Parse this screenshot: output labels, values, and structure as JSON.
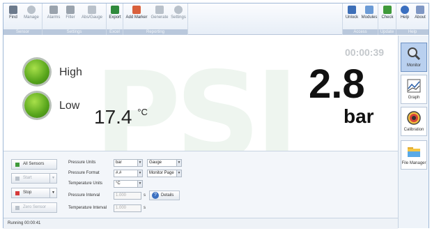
{
  "ribbon": {
    "groups": [
      {
        "label": "Sensor",
        "buttons": [
          {
            "label": "Find",
            "enabled": true
          },
          {
            "label": "Manage",
            "enabled": false
          }
        ]
      },
      {
        "label": "Settings",
        "buttons": [
          {
            "label": "Alarms",
            "enabled": false
          },
          {
            "label": "Filter",
            "enabled": false
          },
          {
            "label": "Abs/Gauge",
            "enabled": false
          }
        ]
      },
      {
        "label": "Excel",
        "buttons": [
          {
            "label": "Export",
            "enabled": true
          }
        ]
      },
      {
        "label": "Reporting",
        "buttons": [
          {
            "label": "Add Marker",
            "enabled": true
          },
          {
            "label": "Generate",
            "enabled": false
          },
          {
            "label": "Settings",
            "enabled": false
          }
        ]
      },
      {
        "label": "Access",
        "buttons": [
          {
            "label": "Unlock",
            "enabled": true
          },
          {
            "label": "Modules",
            "enabled": true
          }
        ]
      },
      {
        "label": "Update",
        "buttons": [
          {
            "label": "Check",
            "enabled": true
          }
        ]
      },
      {
        "label": "Help",
        "buttons": [
          {
            "label": "Help",
            "enabled": true
          },
          {
            "label": "About",
            "enabled": true
          }
        ]
      }
    ]
  },
  "monitor": {
    "timer": "00:00:39",
    "high_label": "High",
    "low_label": "Low",
    "temperature": "17.4",
    "temperature_unit": "°C",
    "pressure": "2.8",
    "pressure_unit": "bar",
    "watermark": "PSI"
  },
  "side": {
    "items": [
      {
        "label": "Monitor",
        "selected": true
      },
      {
        "label": "Graph",
        "selected": false
      },
      {
        "label": "Calibration",
        "selected": false
      },
      {
        "label": "File Manager",
        "selected": false
      }
    ]
  },
  "controls": {
    "all_sensors": "All Sensors",
    "start": "Start",
    "stop": "Stop",
    "zero_sensor": "Zero Sensor",
    "pressure_units_label": "Pressure Units",
    "pressure_units_value": "bar",
    "gauge_value": "Gauge",
    "pressure_format_label": "Pressure Format",
    "pressure_format_value": "#.#",
    "page_value": "Monitor Page",
    "temperature_units_label": "Temperature Units",
    "temperature_units_value": "°C",
    "pressure_interval_label": "Pressure Interval",
    "pressure_interval_value": "1.000",
    "temperature_interval_label": "Temperature Interval",
    "temperature_interval_value": "1.000",
    "seconds_unit": "s",
    "details": "Details"
  },
  "status": {
    "text": "Running 00:00:41"
  },
  "colors": {
    "led": "#56a41b",
    "selected_tab": "#b9d0ef",
    "accent": "#3a6fc0"
  }
}
